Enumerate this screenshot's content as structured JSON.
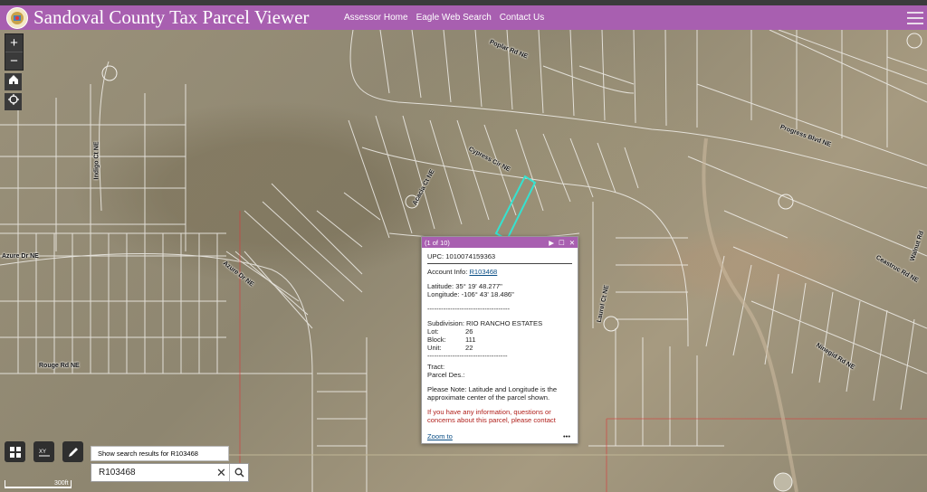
{
  "header": {
    "title": "Sandoval County Tax Parcel Viewer",
    "nav": [
      "Assessor Home",
      "Eagle Web Search",
      "Contact Us"
    ]
  },
  "map": {
    "streets": [
      {
        "name": "Poplar Rd NE"
      },
      {
        "name": "Cypress Cir NE"
      },
      {
        "name": "Acacia Ct NE"
      },
      {
        "name": "Progress Blvd NE"
      },
      {
        "name": "Indigo Ct NE"
      },
      {
        "name": "Azure Dr NE"
      },
      {
        "name": "Azure Dr NE"
      },
      {
        "name": "Rouge Rd NE"
      },
      {
        "name": "Laurel Ct NE"
      },
      {
        "name": "Ceastruc Rd NE"
      },
      {
        "name": "Ninegid Rd NE"
      },
      {
        "name": "Walnut Rd"
      }
    ],
    "scale_label": "300ft"
  },
  "controls": {
    "zoom_in": "+",
    "zoom_out": "−"
  },
  "popup": {
    "counter": "(1 of 10)",
    "upc": "UPC: 1010074159363",
    "account_label": "Account Info:",
    "account_link": "R103468",
    "latitude": "Latitude: 35° 19' 48.277\"",
    "longitude": "Longitude: -106° 43' 18.486\"",
    "divider": "------------------------------------",
    "subdivision": "Subdivision: RIO RANCHO ESTATES",
    "lot_label": "Lot:",
    "lot": "26",
    "block_label": "Block:",
    "block": "111",
    "unit_label": "Unit:",
    "unit": "22",
    "divider2": "-----------------------------------",
    "tract": "Tract:",
    "parcel_des": "Parcel Des.:",
    "note": "Please Note: Latitude and Longitude is the approximate center of the parcel shown.",
    "warning": "If you have any information, questions or concerns about this parcel, please contact",
    "zoom_to": "Zoom to",
    "more": "•••"
  },
  "search": {
    "hint_prefix": "Show search results for",
    "hint_term": "R103468",
    "value": "R103468"
  },
  "colors": {
    "header": "#a85fb0",
    "parcel_line": "#f1efea",
    "selected_parcel": "#35e2d0",
    "boundary": "#d83b3b"
  }
}
